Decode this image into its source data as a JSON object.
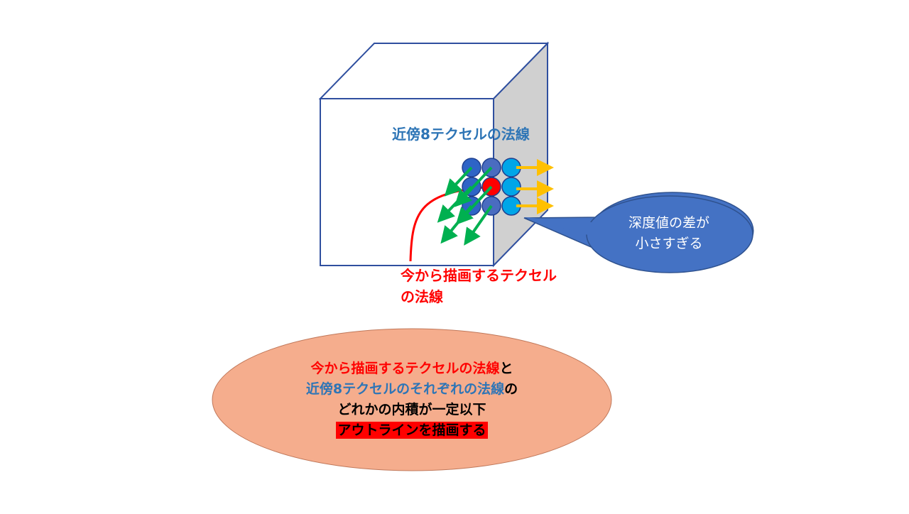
{
  "colors": {
    "accent_blue": "#2e75b6",
    "accent_red": "#ff0000",
    "neighbor_arrow": "#00b050",
    "outward_arrow": "#ffc000",
    "callout_fill": "#4472c4",
    "summary_fill": "#f4b183",
    "side_face": "#d0d0d0"
  },
  "diagram": {
    "neighbors_label": "近傍8テクセルの法線",
    "current_label_line1": "今から描画するテクセル",
    "current_label_line2": "の法線",
    "callout_line1": "深度値の差が",
    "callout_line2": "小さすぎる"
  },
  "summary": {
    "line1_red": "今から描画するテクセルの法線",
    "line1_black": "と",
    "line2_blue": "近傍8テクセルのそれぞれの法線",
    "line2_black": "の",
    "line3": "どれかの内積が一定以下",
    "line4_highlight": "アウトラインを描画する"
  }
}
